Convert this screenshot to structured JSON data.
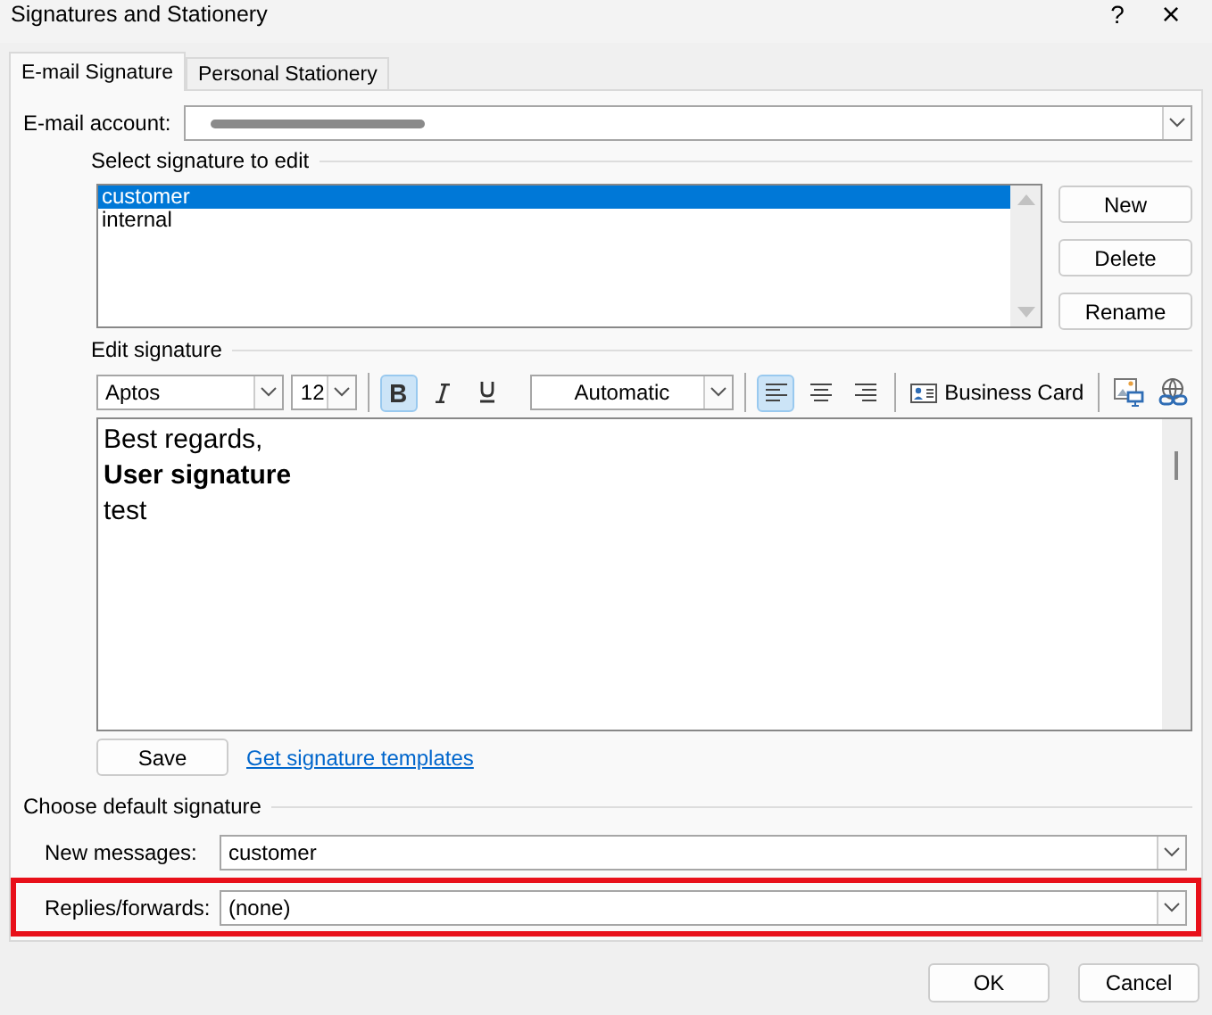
{
  "window": {
    "title": "Signatures and Stationery",
    "help": "?",
    "close": "×"
  },
  "tabs": [
    {
      "label": "E-mail Signature",
      "selected": true
    },
    {
      "label": "Personal Stationery",
      "selected": false
    }
  ],
  "account": {
    "label": "E-mail account:",
    "redacted": true
  },
  "select_section": {
    "title": "Select signature to edit",
    "signatures": [
      {
        "name": "customer",
        "selected": true
      },
      {
        "name": "internal",
        "selected": false
      }
    ],
    "buttons": [
      "New",
      "Delete",
      "Rename"
    ]
  },
  "edit_section": {
    "title": "Edit signature",
    "toolbar": {
      "font": "Aptos",
      "size": "12",
      "bold": true,
      "italic": false,
      "underline": false,
      "font_color": "Automatic",
      "alignments": [
        {
          "kind": "left",
          "selected": true
        },
        {
          "kind": "center",
          "selected": false
        },
        {
          "kind": "right",
          "selected": false
        }
      ],
      "business_card": "Business Card"
    },
    "lines": [
      {
        "text": "Best regards,",
        "bold": false
      },
      {
        "text": "User signature",
        "bold": true
      },
      {
        "text": "test",
        "bold": false
      }
    ],
    "save": "Save",
    "templates_link": "Get signature templates"
  },
  "defaults": {
    "title": "Choose default signature",
    "rows": [
      {
        "label": "New messages:",
        "value": "customer",
        "highlighted": false
      },
      {
        "label": "Replies/forwards:",
        "value": "(none)",
        "highlighted": true
      }
    ]
  },
  "buttons": [
    "OK",
    "Cancel"
  ]
}
